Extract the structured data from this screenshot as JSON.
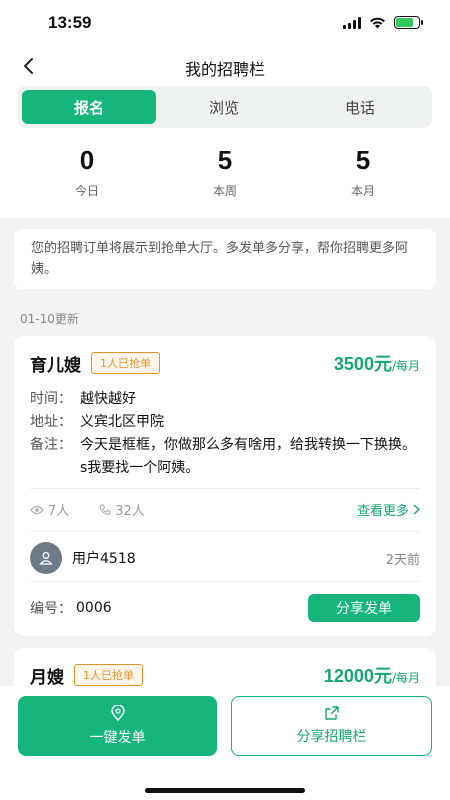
{
  "status_bar": {
    "time": "13:59"
  },
  "nav": {
    "title": "我的招聘栏"
  },
  "tabs": [
    {
      "label": "报名",
      "active": true
    },
    {
      "label": "浏览",
      "active": false
    },
    {
      "label": "电话",
      "active": false
    }
  ],
  "stats": [
    {
      "value": "0",
      "label": "今日"
    },
    {
      "value": "5",
      "label": "本周"
    },
    {
      "value": "5",
      "label": "本月"
    }
  ],
  "notice": "您的招聘订单将展示到抢单大厅。多发单多分享，帮你招聘更多阿姨。",
  "update_date": "01-10更新",
  "cards": [
    {
      "job_type": "育儿嫂",
      "badge": "1人已抢单",
      "salary_amount": "3500元",
      "salary_unit": "/每月",
      "time_label": "时间：",
      "time_value": "越快越好",
      "address_label": "地址：",
      "address_value": "义宾北区甲院",
      "note_label": "备注：",
      "note_value": "今天是框框，你做那么多有啥用，给我转换一下换换。s我要找一个阿姨。",
      "views": "7人",
      "calls": "32人",
      "see_more": "查看更多",
      "user_name": "用户4518",
      "posted": "2天前",
      "order_label": "编号：",
      "order_number": "0006",
      "share_button": "分享发单"
    },
    {
      "job_type": "月嫂",
      "badge": "1人已抢单",
      "salary_amount": "12000元",
      "salary_unit": "/每月"
    }
  ],
  "bottom": {
    "post_label": "一键发单",
    "share_label": "分享招聘栏"
  },
  "colors": {
    "accent": "#15b57b",
    "badge": "#e8912a"
  },
  "icons": [
    "back-icon",
    "eye-icon",
    "phone-icon",
    "chevron-right-icon",
    "user-icon",
    "location-pin-icon",
    "share-icon"
  ]
}
